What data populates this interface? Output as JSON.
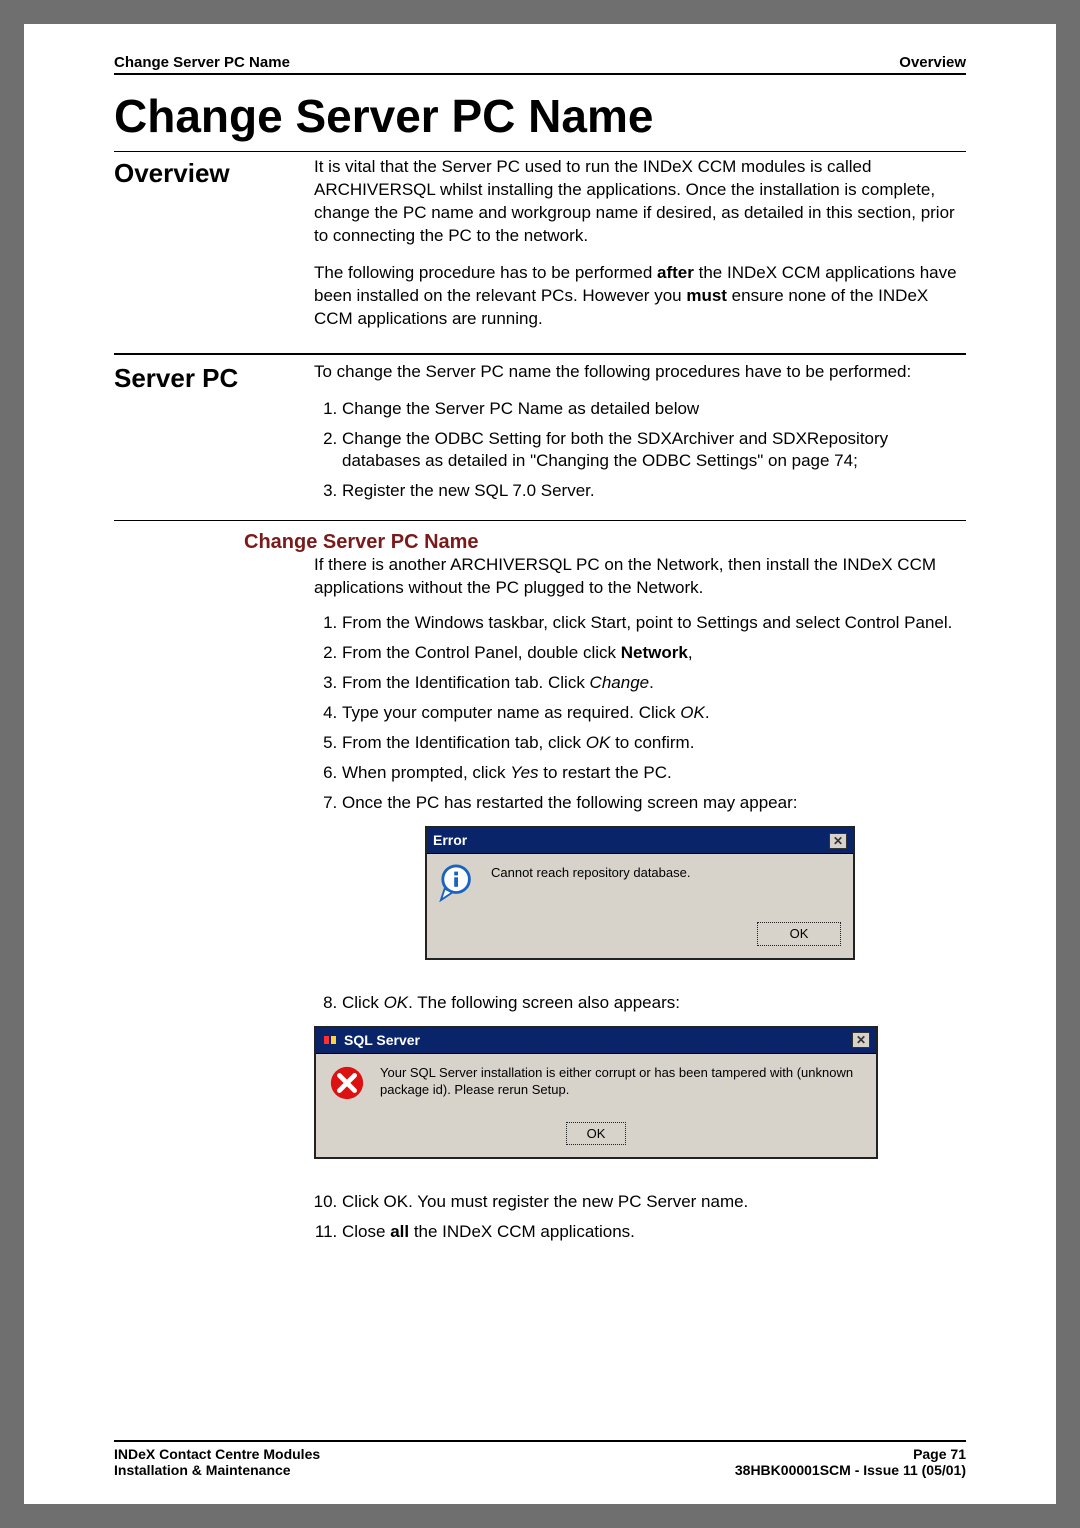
{
  "running_header": {
    "left": "Change Server PC Name",
    "right": "Overview"
  },
  "page_title": "Change Server PC Name",
  "overview": {
    "label": "Overview",
    "para1": "It is vital that the Server PC used to run the INDeX CCM modules is called ARCHIVERSQL whilst installing the applications.  Once the installation is complete, change the PC name and workgroup name if desired, as detailed in this section, prior to connecting the PC to the network.",
    "para2a": "The following procedure has to be performed ",
    "para2b_bold": "after",
    "para2c": " the INDeX CCM applications have been installed on the relevant PCs.  However you ",
    "para2d_bold": "must",
    "para2e": " ensure none of the INDeX CCM applications are running."
  },
  "server_pc": {
    "label": "Server PC",
    "intro": "To change the Server PC name the following procedures have to be performed:",
    "steps": {
      "1": "Change the Server PC Name as detailed below",
      "2": "Change the ODBC Setting for both the SDXArchiver and SDXRepository databases as detailed in \"Changing the ODBC Settings\" on page 74;",
      "3": "Register the new SQL 7.0 Server."
    }
  },
  "subsection": {
    "heading": "Change Server PC Name",
    "intro": "If there is another ARCHIVERSQL PC on the Network, then install the INDeX CCM applications without the PC plugged to the Network.",
    "steps": {
      "1": "From the Windows taskbar, click Start, point to Settings and select Control Panel.",
      "2a": "From the Control Panel, double click ",
      "2b_bold": "Network",
      "2c": ",",
      "3a": "From the Identification tab. Click ",
      "3b_italic": "Change",
      "3c": ".",
      "4a": "Type your computer name as required.  Click ",
      "4b_italic": "OK",
      "4c": ".",
      "5a": "From the Identification tab, click ",
      "5b_italic": "OK",
      "5c": " to confirm.",
      "6a": "When prompted, click ",
      "6b_italic": "Yes",
      "6c": " to restart the PC.",
      "7": "Once the PC has restarted the following screen may appear:"
    },
    "step8a": "Click ",
    "step8b_italic": "OK",
    "step8c": ".  The following screen also appears:",
    "step10": "Click OK.  You must register the new PC Server name.",
    "step11a": "Close ",
    "step11b_bold": "all",
    "step11c": " the INDeX CCM applications."
  },
  "dialog_error": {
    "title": "Error",
    "message": "Cannot reach repository database.",
    "ok": "OK"
  },
  "dialog_sql": {
    "title": "SQL Server",
    "message": "Your SQL Server installation is either corrupt or has been tampered with (unknown package id).  Please rerun Setup.",
    "ok": "OK"
  },
  "footer": {
    "left1": "INDeX Contact Centre Modules",
    "left2": "Installation & Maintenance",
    "right1": "Page 71",
    "right2": "38HBK00001SCM - Issue 11 (05/01)"
  }
}
